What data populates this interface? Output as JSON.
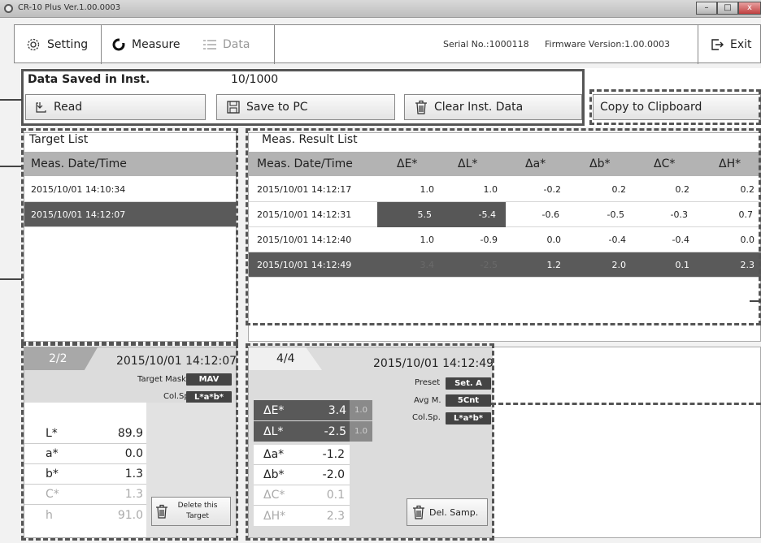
{
  "window": {
    "title": "CR-10 Plus Ver.1.00.0003",
    "minimize_label": "–",
    "maximize_label": "□",
    "close_label": "x"
  },
  "toolbar": {
    "tabs": [
      {
        "label": "Setting",
        "icon": "gear-icon"
      },
      {
        "label": "Measure",
        "icon": "measure-icon"
      },
      {
        "label": "Data",
        "icon": "list-icon"
      }
    ],
    "serial": "Serial No.:1000118",
    "firmware": "Firmware Version:1.00.0003",
    "exit_label": "Exit"
  },
  "instrument": {
    "title": "Data Saved in Inst.",
    "count": "10/1000",
    "read_label": "Read",
    "save_label": "Save to PC",
    "clear_label": "Clear Inst. Data",
    "copy_label": "Copy to Clipboard"
  },
  "target_list": {
    "title": "Target List",
    "header": "Meas. Date/Time",
    "rows": [
      "2015/10/01 14:10:34",
      "2015/10/01 14:12:07"
    ],
    "selected_index": 1
  },
  "result_list": {
    "title": "Meas. Result List",
    "headers": [
      "Meas. Date/Time",
      "ΔE*",
      "ΔL*",
      "Δa*",
      "Δb*",
      "ΔC*",
      "ΔH*"
    ],
    "rows": [
      [
        "2015/10/01 14:12:17",
        "1.0",
        "1.0",
        "-0.2",
        "0.2",
        "0.2",
        "0.2"
      ],
      [
        "2015/10/01 14:12:31",
        "5.5",
        "-5.4",
        "-0.6",
        "-0.5",
        "-0.3",
        "0.7"
      ],
      [
        "2015/10/01 14:12:40",
        "1.0",
        "-0.9",
        "0.0",
        "-0.4",
        "-0.4",
        "0.0"
      ],
      [
        "2015/10/01 14:12:49",
        "3.4",
        "-2.5",
        "1.2",
        "2.0",
        "0.1",
        "2.3"
      ]
    ],
    "selected_index": 3
  },
  "target_detail": {
    "index": "2/2",
    "datetime": "2015/10/01 14:12:07",
    "mask_label": "Target Mask",
    "mask_value": "MAV",
    "colsp_label": "Col.Sp.",
    "colsp_value": "L*a*b*",
    "values": [
      {
        "label": "L*",
        "value": "89.9"
      },
      {
        "label": "a*",
        "value": "0.0"
      },
      {
        "label": "b*",
        "value": "1.3"
      },
      {
        "label": "C*",
        "value": "1.3"
      },
      {
        "label": "h",
        "value": "91.0"
      }
    ],
    "delete_label": "Delete this Target"
  },
  "sample_detail": {
    "index": "4/4",
    "datetime": "2015/10/01 14:12:49",
    "preset_label": "Preset",
    "preset_value": "Set. A",
    "avg_label": "Avg M.",
    "avg_value": "5Cnt",
    "colsp_label": "Col.Sp.",
    "colsp_value": "L*a*b*",
    "values": [
      {
        "label": "ΔE*",
        "value": "3.4",
        "tol": "1.0"
      },
      {
        "label": "ΔL*",
        "value": "-2.5",
        "tol": "1.0"
      },
      {
        "label": "Δa*",
        "value": "-1.2"
      },
      {
        "label": "Δb*",
        "value": "-2.0"
      },
      {
        "label": "ΔC*",
        "value": "0.1"
      },
      {
        "label": "ΔH*",
        "value": "2.3"
      }
    ],
    "delete_label": "Del. Samp."
  }
}
